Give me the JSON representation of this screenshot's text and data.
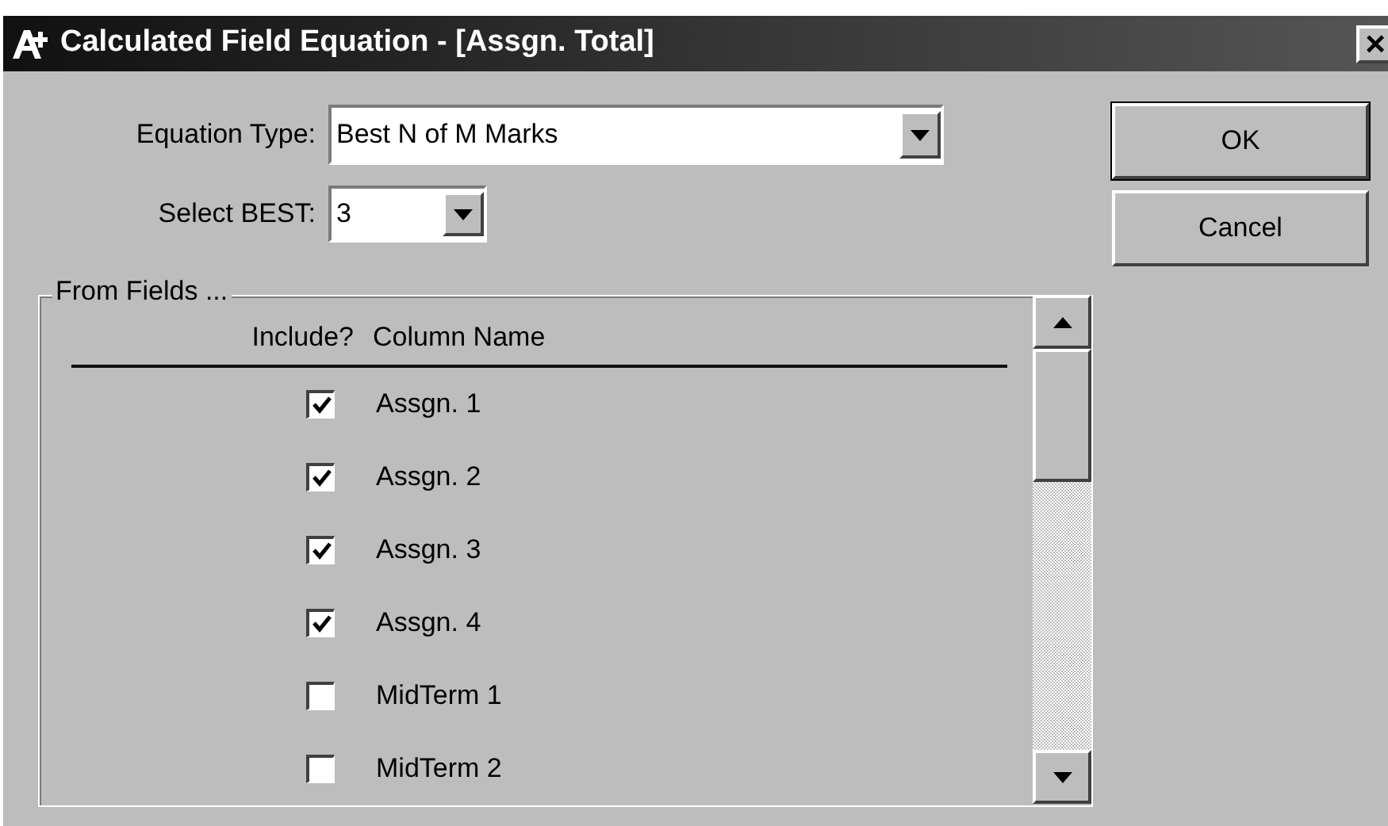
{
  "window": {
    "title": "Calculated Field Equation - [Assgn. Total]",
    "close": "×"
  },
  "equation_type": {
    "label": "Equation Type:",
    "value": "Best N of M Marks"
  },
  "select_best": {
    "label": "Select BEST:",
    "value": "3"
  },
  "buttons": [
    "OK",
    "Cancel"
  ],
  "from_fields": {
    "title": "From Fields ...",
    "columns": [
      "Include?",
      "Column Name"
    ],
    "rows": [
      {
        "name": "Assgn. 1",
        "checked": true
      },
      {
        "name": "Assgn. 2",
        "checked": true
      },
      {
        "name": "Assgn. 3",
        "checked": true
      },
      {
        "name": "Assgn. 4",
        "checked": true
      },
      {
        "name": "MidTerm 1",
        "checked": false
      },
      {
        "name": "MidTerm 2",
        "checked": false
      }
    ]
  }
}
